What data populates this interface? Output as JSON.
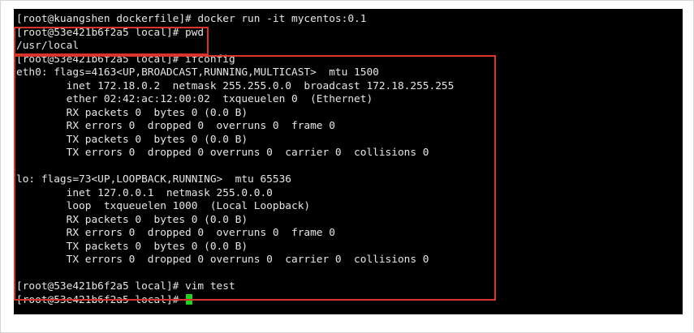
{
  "colors": {
    "terminal_background": "#000000",
    "terminal_text": "#e6e6e6",
    "cursor": "#25d025",
    "highlight_box": "#d9342b"
  },
  "terminal": {
    "lines": [
      "[root@kuangshen dockerfile]# docker run -it mycentos:0.1",
      "[root@53e421b6f2a5 local]# pwd",
      "/usr/local",
      "[root@53e421b6f2a5 local]# ifconfig",
      "eth0: flags=4163<UP,BROADCAST,RUNNING,MULTICAST>  mtu 1500",
      "        inet 172.18.0.2  netmask 255.255.0.0  broadcast 172.18.255.255",
      "        ether 02:42:ac:12:00:02  txqueuelen 0  (Ethernet)",
      "        RX packets 0  bytes 0 (0.0 B)",
      "        RX errors 0  dropped 0  overruns 0  frame 0",
      "        TX packets 0  bytes 0 (0.0 B)",
      "        TX errors 0  dropped 0 overruns 0  carrier 0  collisions 0",
      "",
      "lo: flags=73<UP,LOOPBACK,RUNNING>  mtu 65536",
      "        inet 127.0.0.1  netmask 255.0.0.0",
      "        loop  txqueuelen 1000  (Local Loopback)",
      "        RX packets 0  bytes 0 (0.0 B)",
      "        RX errors 0  dropped 0  overruns 0  frame 0",
      "        TX packets 0  bytes 0 (0.0 B)",
      "        TX errors 0  dropped 0 overruns 0  carrier 0  collisions 0",
      "",
      "[root@53e421b6f2a5 local]# vim test",
      "[root@53e421b6f2a5 local]# "
    ]
  }
}
